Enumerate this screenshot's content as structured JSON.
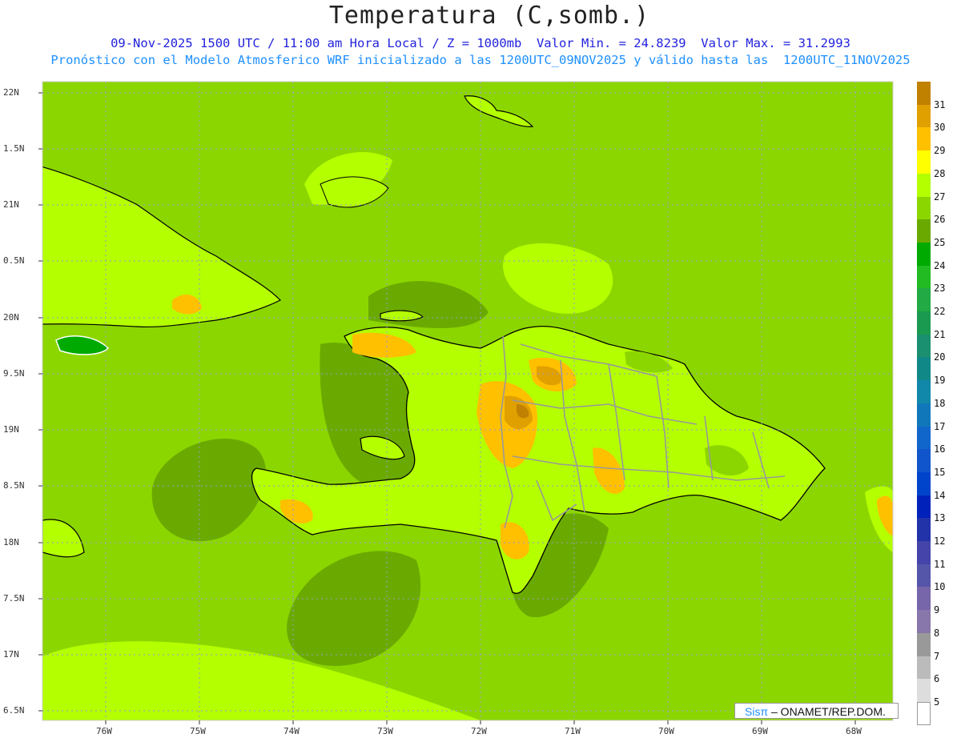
{
  "title": "Temperatura (C,somb.)",
  "subtitle_line1": "09-Nov-2025 1500 UTC / 11:00 am Hora Local / Z = 1000mb  Valor Min. = 24.8239  Valor Max. = 31.2993",
  "subtitle_line2": "Pronóstico con el Modelo Atmosferico WRF inicializado a las 1200UTC_09NOV2025 y válido hasta las  1200UTC_11NOV2025",
  "credit": {
    "brand": "Sisπ",
    "text": "– ONAMET/REP.DOM."
  },
  "lat_labels": [
    "22N",
    "1.5N",
    "21N",
    "0.5N",
    "20N",
    "9.5N",
    "19N",
    "8.5N",
    "18N",
    "7.5N",
    "17N",
    "6.5N"
  ],
  "lon_labels": [
    "76W",
    "75W",
    "74W",
    "73W",
    "72W",
    "71W",
    "70W",
    "69W",
    "68W"
  ],
  "colorbar": {
    "labels": [
      "31",
      "30",
      "29",
      "28",
      "27",
      "26",
      "25",
      "24",
      "23",
      "22",
      "21",
      "20",
      "19",
      "18",
      "17",
      "16",
      "15",
      "14",
      "13",
      "12",
      "11",
      "10",
      "9",
      "8",
      "7",
      "6",
      "5"
    ],
    "colors": [
      "#c08000",
      "#e0a000",
      "#ffc000",
      "#ffff00",
      "#b4ff00",
      "#8cd600",
      "#6aaa00",
      "#00aa00",
      "#22bb22",
      "#22aa44",
      "#1a9a50",
      "#1a9070",
      "#118888",
      "#1188aa",
      "#1177bb",
      "#1166cc",
      "#1155cc",
      "#0044cc",
      "#0022bb",
      "#2233aa",
      "#4444aa",
      "#5555aa",
      "#7766aa",
      "#8877aa",
      "#999999",
      "#bbbbbb",
      "#dddddd",
      "#ffffff"
    ]
  },
  "map_colors": {
    "sea": "#8cd600",
    "sea_dark": "#6aaa00",
    "land_warm": "#b4ff00",
    "hot": "#ffc000",
    "hotter": "#e0a000",
    "hottest": "#c08000",
    "cool_land": "#00aa00",
    "coast": "#000000",
    "border": "#999999",
    "grid": "#9999cc"
  }
}
